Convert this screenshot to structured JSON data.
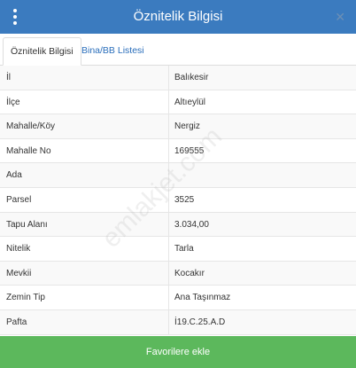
{
  "header": {
    "title": "Öznitelik Bilgisi",
    "close_symbol": "✕"
  },
  "tabs": [
    {
      "label": "Öznitelik Bilgisi",
      "active": true
    },
    {
      "label": "Bina/BB Listesi",
      "active": false
    }
  ],
  "rows": [
    {
      "key": "İl",
      "value": "Balıkesir"
    },
    {
      "key": "İlçe",
      "value": "Altıeylül"
    },
    {
      "key": "Mahalle/Köy",
      "value": "Nergiz"
    },
    {
      "key": "Mahalle No",
      "value": "169555"
    },
    {
      "key": "Ada",
      "value": ""
    },
    {
      "key": "Parsel",
      "value": "3525"
    },
    {
      "key": "Tapu Alanı",
      "value": "3.034,00"
    },
    {
      "key": "Nitelik",
      "value": "Tarla"
    },
    {
      "key": "Mevkii",
      "value": "Kocakır"
    },
    {
      "key": "Zemin Tip",
      "value": "Ana Taşınmaz"
    },
    {
      "key": "Pafta",
      "value": "İ19.C.25.A.D"
    }
  ],
  "watermark": "emlakjet.com",
  "footer": {
    "button_label": "Favorilere ekle"
  },
  "colors": {
    "header": "#3b7bbf",
    "button": "#5cb85c",
    "tab_link": "#2a6ebb"
  }
}
